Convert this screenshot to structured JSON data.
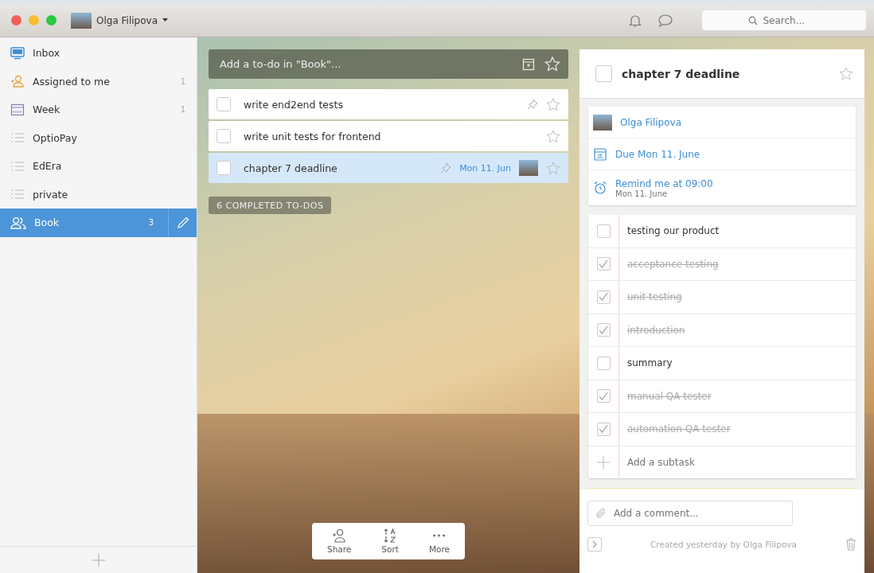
{
  "window": {
    "user": "Olga Filipova",
    "search": {
      "placeholder": "Search..."
    }
  },
  "sidebar": {
    "items": [
      {
        "kind": "inbox",
        "label": "Inbox",
        "selected": false
      },
      {
        "kind": "assigned",
        "label": "Assigned to me",
        "count": "1",
        "selected": false
      },
      {
        "kind": "week",
        "label": "Week",
        "count": "1",
        "selected": false
      },
      {
        "kind": "list",
        "label": "OptioPay",
        "selected": false
      },
      {
        "kind": "list",
        "label": "EdEra",
        "selected": false
      },
      {
        "kind": "list",
        "label": "private",
        "selected": false
      },
      {
        "kind": "shared",
        "label": "Book",
        "count": "3",
        "selected": true
      }
    ]
  },
  "add_todo": {
    "placeholder": "Add a to-do in \"Book\"..."
  },
  "todos": [
    {
      "title": "write end2end tests",
      "reminder": true,
      "starred": false,
      "selected": false
    },
    {
      "title": "write unit tests for frontend",
      "reminder": false,
      "starred": false,
      "selected": false
    },
    {
      "title": "chapter 7 deadline",
      "reminder": true,
      "due": "Mon 11. Jun",
      "assigned": true,
      "starred": false,
      "selected": true
    }
  ],
  "completed_button": "6 COMPLETED TO-DOS",
  "toolbar": [
    {
      "kind": "share",
      "label": "Share"
    },
    {
      "kind": "sort",
      "label": "Sort"
    },
    {
      "kind": "more",
      "label": "More"
    }
  ],
  "detail": {
    "title": "chapter 7 deadline",
    "checked": false,
    "starred": false,
    "assignee": "Olga Filipova",
    "due": "Due Mon 11. June",
    "reminder": "Remind me at 09:00",
    "reminder_date": "Mon 11. June",
    "subtasks": [
      {
        "title": "testing our product",
        "checked": false
      },
      {
        "title": "acceptance testing",
        "checked": true
      },
      {
        "title": "unit testing",
        "checked": true
      },
      {
        "title": "introduction",
        "checked": true
      },
      {
        "title": "summary",
        "checked": false
      },
      {
        "title": "manual QA tester",
        "checked": true
      },
      {
        "title": "automation QA tester",
        "checked": true
      }
    ],
    "add_subtask": {
      "placeholder": "Add a subtask"
    },
    "comment": {
      "placeholder": "Add a comment..."
    },
    "created": "Created yesterday by Olga Filipova"
  }
}
